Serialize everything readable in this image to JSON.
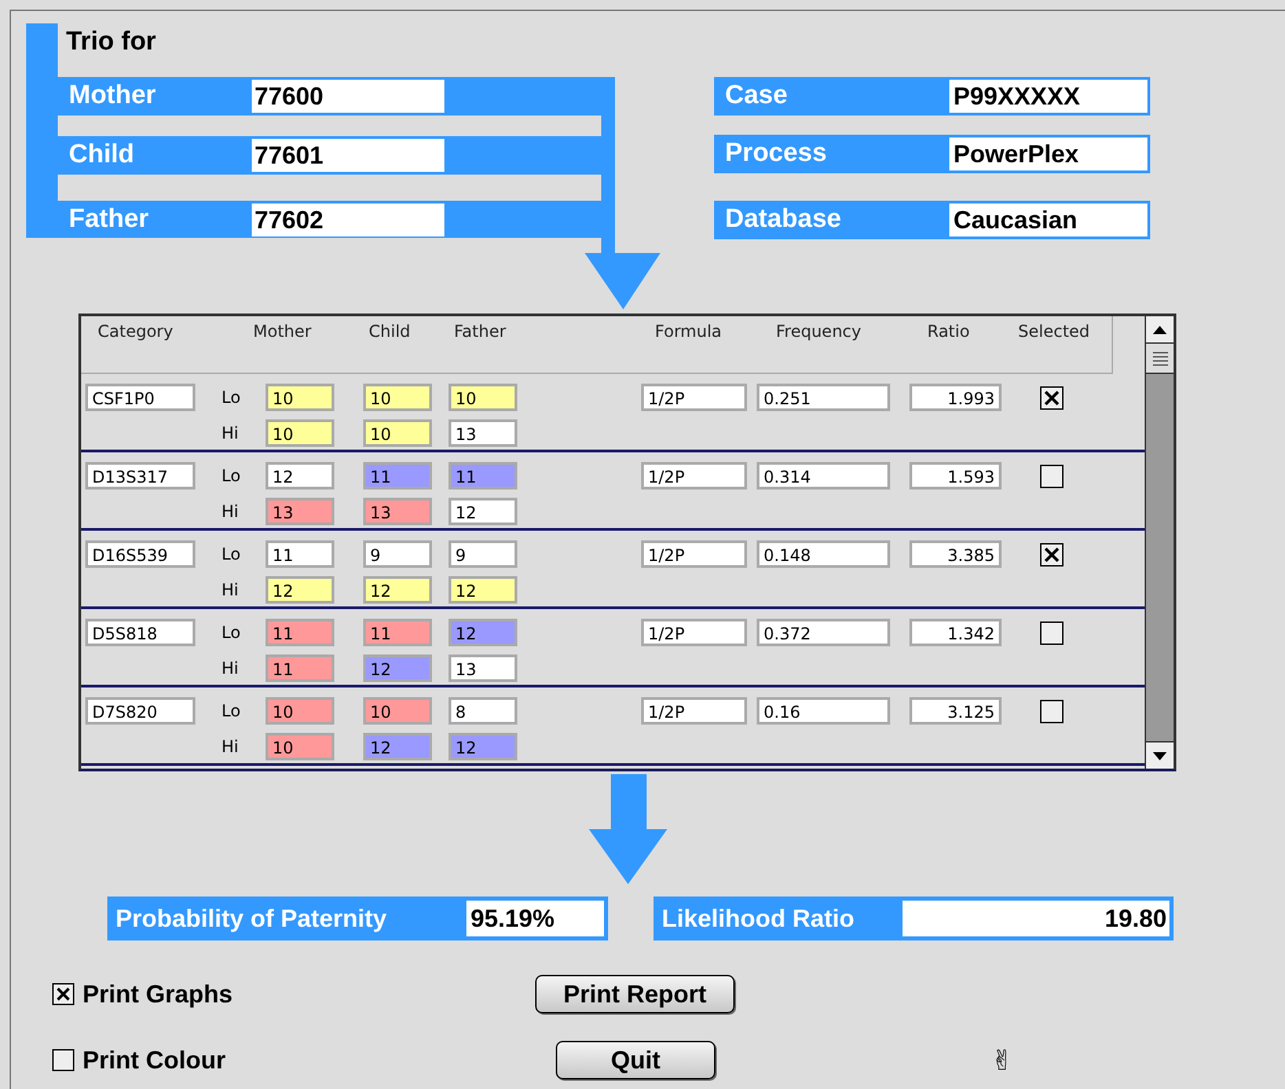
{
  "trio": {
    "title": "Trio for",
    "members": [
      {
        "label": "Mother",
        "value": "77600"
      },
      {
        "label": "Child",
        "value": "77601"
      },
      {
        "label": "Father",
        "value": "77602"
      }
    ]
  },
  "case_info": [
    {
      "label": "Case",
      "value": "P99XXXXX"
    },
    {
      "label": "Process",
      "value": "PowerPlex"
    },
    {
      "label": "Database",
      "value": "Caucasian"
    }
  ],
  "table": {
    "columns": [
      "Category",
      "Mother",
      "Child",
      "Father",
      "Formula",
      "Frequency",
      "Ratio",
      "Selected"
    ],
    "rows": [
      {
        "category": "CSF1P0",
        "alleles": [
          {
            "label": "Lo",
            "cells": [
              {
                "value": "10",
                "color": "#ffff99"
              },
              {
                "value": "10",
                "color": "#ffff99"
              },
              {
                "value": "10",
                "color": "#ffff99"
              }
            ]
          },
          {
            "label": "Hi",
            "cells": [
              {
                "value": "10",
                "color": "#ffff99"
              },
              {
                "value": "10",
                "color": "#ffff99"
              },
              {
                "value": "13",
                "color": "#ffffff"
              }
            ]
          }
        ],
        "formula": "1/2P",
        "frequency": "0.251",
        "ratio": "1.993",
        "selected": true
      },
      {
        "category": "D13S317",
        "alleles": [
          {
            "label": "Lo",
            "cells": [
              {
                "value": "12",
                "color": "#ffffff"
              },
              {
                "value": "11",
                "color": "#9999ff"
              },
              {
                "value": "11",
                "color": "#9999ff"
              }
            ]
          },
          {
            "label": "Hi",
            "cells": [
              {
                "value": "13",
                "color": "#ff9999"
              },
              {
                "value": "13",
                "color": "#ff9999"
              },
              {
                "value": "12",
                "color": "#ffffff"
              }
            ]
          }
        ],
        "formula": "1/2P",
        "frequency": "0.314",
        "ratio": "1.593",
        "selected": false
      },
      {
        "category": "D16S539",
        "alleles": [
          {
            "label": "Lo",
            "cells": [
              {
                "value": "11",
                "color": "#ffffff"
              },
              {
                "value": "9",
                "color": "#ffffff"
              },
              {
                "value": "9",
                "color": "#ffffff"
              }
            ]
          },
          {
            "label": "Hi",
            "cells": [
              {
                "value": "12",
                "color": "#ffff99"
              },
              {
                "value": "12",
                "color": "#ffff99"
              },
              {
                "value": "12",
                "color": "#ffff99"
              }
            ]
          }
        ],
        "formula": "1/2P",
        "frequency": "0.148",
        "ratio": "3.385",
        "selected": true
      },
      {
        "category": "D5S818",
        "alleles": [
          {
            "label": "Lo",
            "cells": [
              {
                "value": "11",
                "color": "#ff9999"
              },
              {
                "value": "11",
                "color": "#ff9999"
              },
              {
                "value": "12",
                "color": "#9999ff"
              }
            ]
          },
          {
            "label": "Hi",
            "cells": [
              {
                "value": "11",
                "color": "#ff9999"
              },
              {
                "value": "12",
                "color": "#9999ff"
              },
              {
                "value": "13",
                "color": "#ffffff"
              }
            ]
          }
        ],
        "formula": "1/2P",
        "frequency": "0.372",
        "ratio": "1.342",
        "selected": false
      },
      {
        "category": "D7S820",
        "alleles": [
          {
            "label": "Lo",
            "cells": [
              {
                "value": "10",
                "color": "#ff9999"
              },
              {
                "value": "10",
                "color": "#ff9999"
              },
              {
                "value": "8",
                "color": "#ffffff"
              }
            ]
          },
          {
            "label": "Hi",
            "cells": [
              {
                "value": "10",
                "color": "#ff9999"
              },
              {
                "value": "12",
                "color": "#9999ff"
              },
              {
                "value": "12",
                "color": "#9999ff"
              }
            ]
          }
        ],
        "formula": "1/2P",
        "frequency": "0.16",
        "ratio": "3.125",
        "selected": false
      }
    ]
  },
  "results": [
    {
      "label": "Probability of Paternity",
      "value": "95.19%"
    },
    {
      "label": "Likelihood Ratio",
      "value": "19.80"
    }
  ],
  "options": [
    {
      "label": "Print Graphs",
      "checked": true
    },
    {
      "label": "Print Colour",
      "checked": false
    }
  ],
  "buttons": [
    "Print Report",
    "Quit"
  ],
  "cursor": "✌"
}
